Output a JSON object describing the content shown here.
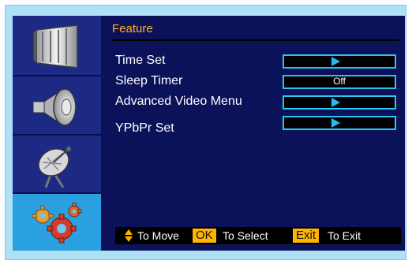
{
  "menu": {
    "title": "Feature",
    "items": [
      {
        "label": "Time Set",
        "value": ""
      },
      {
        "label": "Sleep Timer",
        "value": "Off"
      },
      {
        "label": "Advanced Video Menu",
        "value": ""
      },
      {
        "label": "YPbPr Set",
        "value": ""
      }
    ]
  },
  "sidebar": {
    "items": [
      {
        "name": "picture",
        "icon": "tv-panel-icon"
      },
      {
        "name": "audio",
        "icon": "speaker-icon"
      },
      {
        "name": "channel",
        "icon": "satellite-dish-icon"
      },
      {
        "name": "feature",
        "icon": "gears-icon"
      }
    ]
  },
  "footer": {
    "move_text": "To Move",
    "ok_key": "OK",
    "select_text": "To Select",
    "exit_key": "Exit",
    "exit_text": "To Exit"
  },
  "colors": {
    "accent": "#ffb12b",
    "selected_tile": "#2aa0e0",
    "box_border": "#2bc3ef"
  }
}
